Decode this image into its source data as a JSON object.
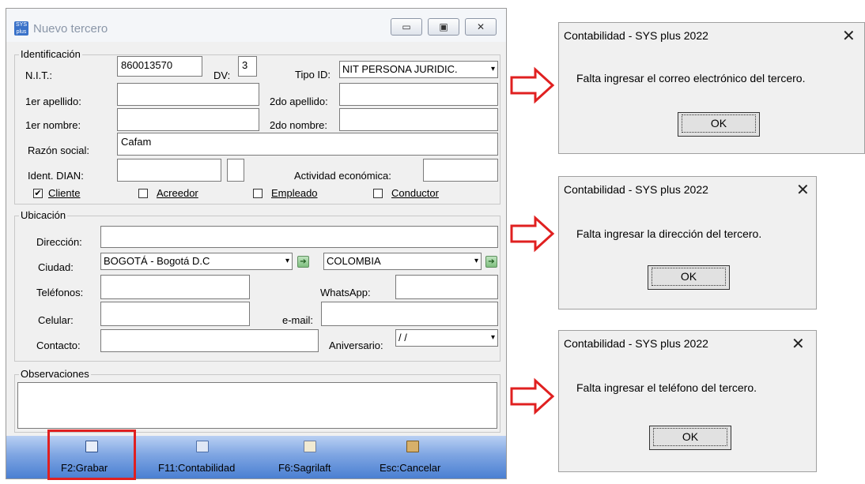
{
  "window": {
    "title": "Nuevo tercero",
    "icon_name": "app-logo-icon",
    "minimize_icon": "minimize-icon",
    "maximize_icon": "maximize-icon",
    "close_icon": "close-icon"
  },
  "identificacion": {
    "legend": "Identificación",
    "nit_label": "N.I.T.:",
    "nit_value": "860013570",
    "dv_label": "DV:",
    "dv_value": "3",
    "tipo_id_label": "Tipo ID:",
    "tipo_id_value": "NIT PERSONA JURIDIC.",
    "apellido1_label": "1er apellido:",
    "apellido2_label": "2do apellido:",
    "nombre1_label": "1er nombre:",
    "nombre2_label": "2do nombre:",
    "razon_label": "Razón social:",
    "razon_value": "Cafam",
    "ident_dian_label": "Ident. DIAN:",
    "actividad_label": "Actividad económica:",
    "checkboxes": [
      {
        "label": "Cliente",
        "checked": true
      },
      {
        "label": "Acreedor",
        "checked": false
      },
      {
        "label": "Empleado",
        "checked": false
      },
      {
        "label": "Conductor",
        "checked": false
      }
    ]
  },
  "ubicacion": {
    "legend": "Ubicación",
    "direccion_label": "Dirección:",
    "ciudad_label": "Ciudad:",
    "ciudad_value": "BOGOTÁ - Bogotá D.C",
    "pais_value": "COLOMBIA",
    "telefonos_label": "Teléfonos:",
    "whatsapp_label": "WhatsApp:",
    "celular_label": "Celular:",
    "email_label": "e-mail:",
    "contacto_label": "Contacto:",
    "aniversario_label": "Aniversario:",
    "aniversario_value": " / /"
  },
  "observaciones": {
    "legend": "Observaciones"
  },
  "toolbar": {
    "grabar": "F2:Grabar",
    "contabilidad": "F11:Contabilidad",
    "sagrilaft": "F6:Sagrilaft",
    "cancelar": "Esc:Cancelar",
    "highlight_color": "#e02020"
  },
  "dialogs": [
    {
      "title": "Contabilidad - SYS plus 2022",
      "message": "Falta ingresar el correo electrónico del tercero.",
      "ok": "OK"
    },
    {
      "title": "Contabilidad - SYS plus 2022",
      "message": "Falta ingresar la dirección del tercero.",
      "ok": "OK"
    },
    {
      "title": "Contabilidad - SYS plus 2022",
      "message": "Falta ingresar el teléfono del tercero.",
      "ok": "OK"
    }
  ],
  "colors": {
    "arrow": "#e02020",
    "toolbar_gradient_bottom": "#4a7fd2"
  }
}
